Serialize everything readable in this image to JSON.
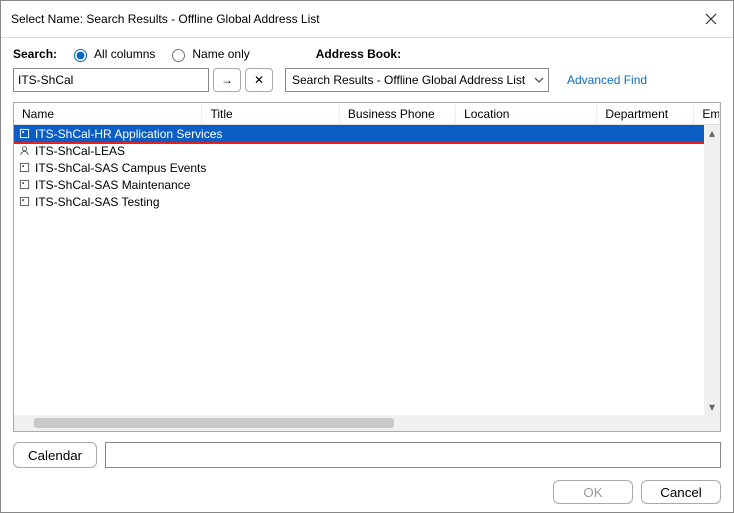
{
  "window": {
    "title": "Select Name: Search Results - Offline Global Address List"
  },
  "search": {
    "label": "Search:",
    "radio_all": "All columns",
    "radio_name": "Name only",
    "input_value": "ITS-ShCal",
    "go_glyph": "→",
    "clear_glyph": "✕"
  },
  "address_book": {
    "label": "Address Book:",
    "selected": "Search Results - Offline Global Address List",
    "advanced": "Advanced Find"
  },
  "grid": {
    "columns": {
      "name": "Name",
      "title": "Title",
      "phone": "Business Phone",
      "location": "Location",
      "department": "Department",
      "email": "Email"
    },
    "rows": [
      {
        "icon": "box",
        "name": "ITS-ShCal-HR Application Services",
        "selected": true,
        "trail": ""
      },
      {
        "icon": "person",
        "name": "ITS-ShCal-LEAS",
        "selected": false,
        "trail": "n"
      },
      {
        "icon": "box",
        "name": "ITS-ShCal-SAS Campus Events",
        "selected": false,
        "trail": "n"
      },
      {
        "icon": "box",
        "name": "ITS-ShCal-SAS Maintenance",
        "selected": false,
        "trail": "n"
      },
      {
        "icon": "box",
        "name": "ITS-ShCal-SAS Testing",
        "selected": false,
        "trail": "n"
      }
    ]
  },
  "footer": {
    "calendar_btn": "Calendar",
    "ok": "OK",
    "cancel": "Cancel"
  }
}
